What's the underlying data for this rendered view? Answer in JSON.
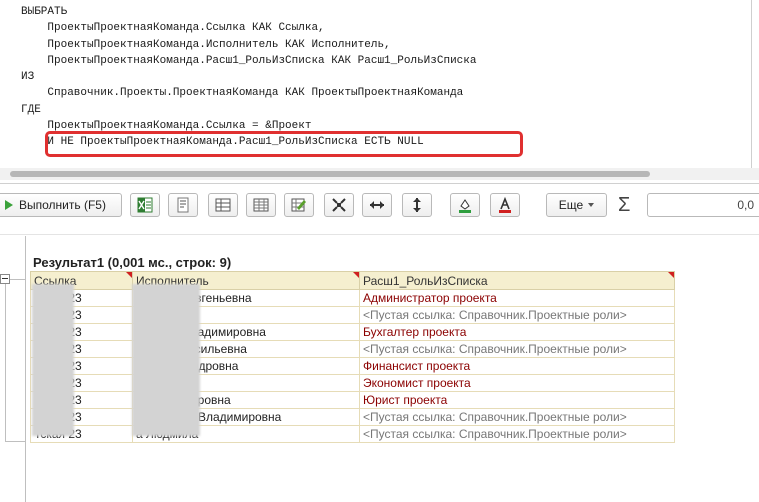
{
  "editor": {
    "lines": [
      "ВЫБРАТЬ",
      "    ПроектыПроектнаяКоманда.Ссылка КАК Ссылка,",
      "    ПроектыПроектнаяКоманда.Исполнитель КАК Исполнитель,",
      "    ПроектыПроектнаяКоманда.Расш1_РольИзСписка КАК Расш1_РольИзСписка",
      "ИЗ",
      "    Справочник.Проекты.ПроектнаяКоманда КАК ПроектыПроектнаяКоманда",
      "ГДЕ",
      "    ПроектыПроектнаяКоманда.Ссылка = &Проект",
      "    И НЕ ПроектыПроектнаяКоманда.Расш1_РольИзСписка ЕСТЬ NULL"
    ],
    "highlight_color": "#e03030"
  },
  "toolbar": {
    "run_label": "Выполнить (F5)",
    "more_label": "Еще",
    "sum_label": "Σ",
    "sum_value": "0,0",
    "icons": [
      "excel-icon",
      "text-icon",
      "table-icon",
      "grid-icon",
      "edit-table-icon",
      "fit-icon",
      "width-icon",
      "height-icon",
      "fill-color-icon",
      "font-color-icon"
    ]
  },
  "results": {
    "title": "Результат1 (0,001 мс., строк: 9)",
    "columns": [
      "Ссылка",
      "Исполнитель",
      "Расш1_РольИзСписка"
    ],
    "rows": [
      [
        "тская 23",
        "а Жанна Евгеньевна",
        "Администратор проекта",
        "red"
      ],
      [
        "тская 23",
        "",
        "<Пустая ссылка: Справочник.Проектные роли>",
        "grey"
      ],
      [
        "тская 23",
        "а Ольга Владимировна",
        "Бухгалтер проекта",
        "red"
      ],
      [
        "тская 23",
        "Лариса Васильевна",
        "<Пустая ссылка: Справочник.Проектные роли>",
        "grey"
      ],
      [
        "тская 23",
        "ья Александровна",
        "Финансист проекта",
        "red"
      ],
      [
        "тская 23",
        "ина",
        "Экономист проекта",
        "red"
      ],
      [
        "тская 23",
        "а Анна Петровна",
        "Юрист проекта",
        "red"
      ],
      [
        "тская 23",
        "Екатерина Владимировна",
        "<Пустая ссылка: Справочник.Проектные роли>",
        "grey"
      ],
      [
        "тская 23",
        "а Людмила",
        "<Пустая ссылка: Справочник.Проектные роли>",
        "grey"
      ]
    ]
  }
}
